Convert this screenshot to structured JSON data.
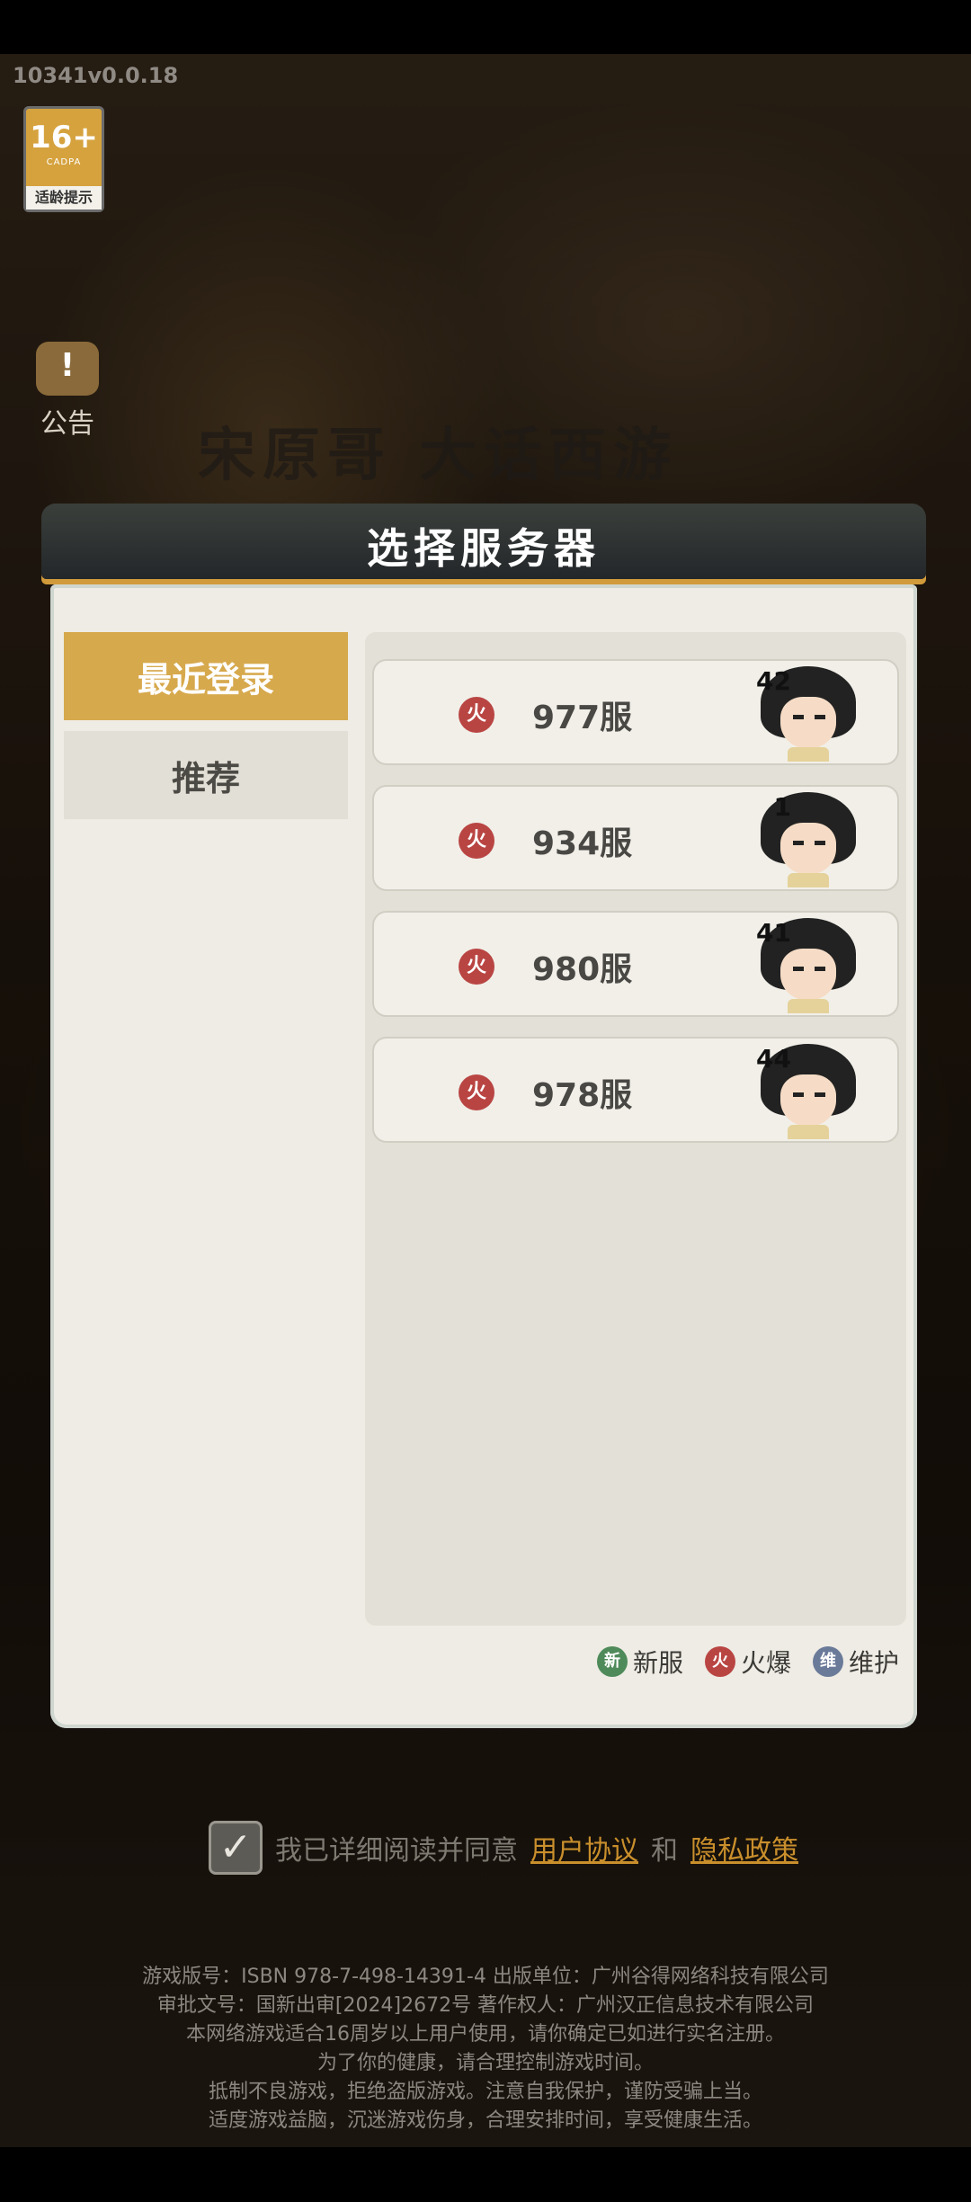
{
  "version": "10341v0.0.18",
  "age_badge": {
    "number": "16+",
    "tag": "CADPA",
    "label": "适龄提示"
  },
  "notice": {
    "label": "公告"
  },
  "game_logo": "宋原哥 大话西游",
  "dialog": {
    "title": "选择服务器",
    "tabs": [
      {
        "label": "最近登录",
        "active": true
      },
      {
        "label": "推荐",
        "active": false
      }
    ],
    "servers": [
      {
        "name": "977服",
        "status_icon": "hot-icon",
        "level": "42"
      },
      {
        "name": "934服",
        "status_icon": "hot-icon",
        "level": "1"
      },
      {
        "name": "980服",
        "status_icon": "hot-icon",
        "level": "41"
      },
      {
        "name": "978服",
        "status_icon": "hot-icon",
        "level": "44"
      }
    ],
    "legend": [
      {
        "icon": "new-server-icon",
        "glyph": "新",
        "label": "新服",
        "color": "#4f8a5a"
      },
      {
        "icon": "hot-icon",
        "glyph": "火",
        "label": "火爆",
        "color": "#b94543"
      },
      {
        "icon": "maintenance-icon",
        "glyph": "维",
        "label": "维护",
        "color": "#6a7a99"
      }
    ]
  },
  "agreement": {
    "prefix": "我已详细阅读并同意",
    "user_agreement": "用户协议",
    "and": "和",
    "privacy_policy": "隐私政策",
    "checked": true
  },
  "footer": {
    "lines": [
      "游戏版号：ISBN 978-7-498-14391-4 出版单位：广州谷得网络科技有限公司",
      "审批文号：国新出审[2024]2672号 著作权人：广州汉正信息技术有限公司",
      "本网络游戏适合16周岁以上用户使用，请你确定已如进行实名注册。",
      "为了你的健康，请合理控制游戏时间。",
      "抵制不良游戏，拒绝盗版游戏。注意自我保护，谨防受骗上当。",
      "适度游戏益脑，沉迷游戏伤身，合理安排时间，享受健康生活。"
    ]
  }
}
